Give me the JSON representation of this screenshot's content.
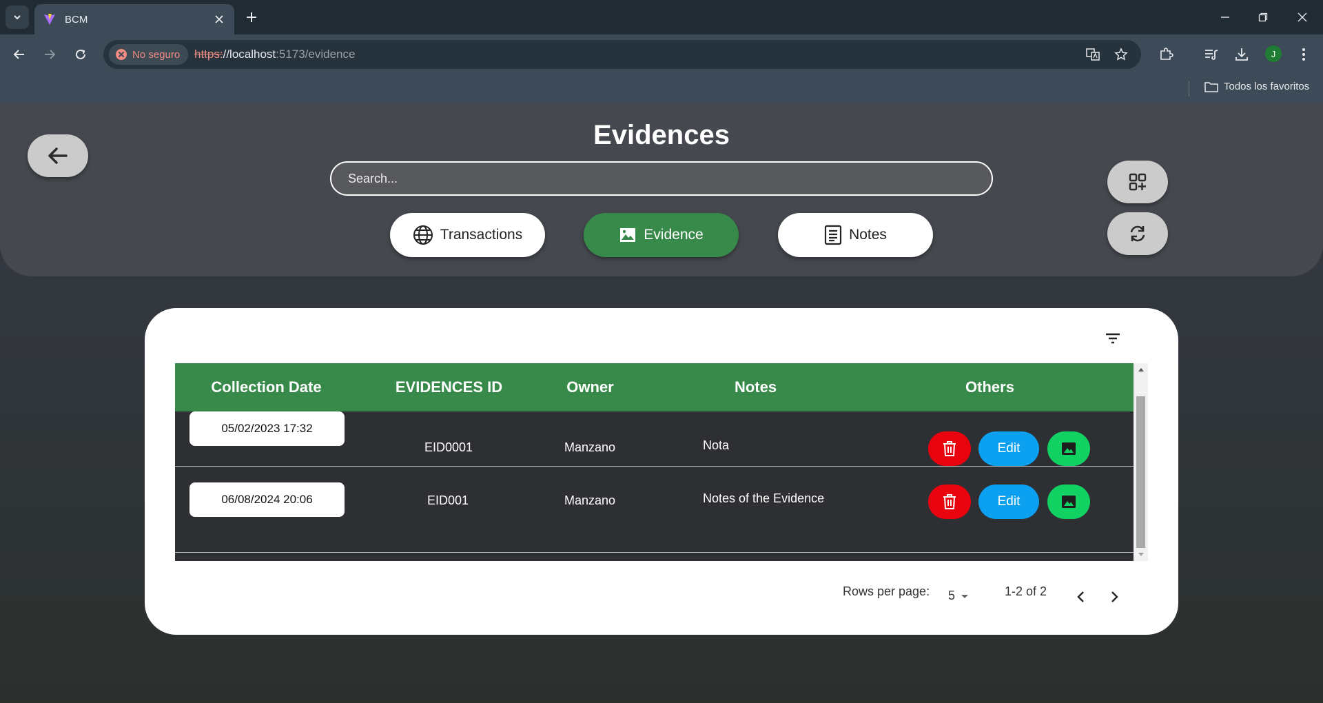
{
  "browser": {
    "tab_title": "BCM",
    "security_label": "No seguro",
    "url_scheme": "https:",
    "url_host": "//localhost",
    "url_rest": ":5173/evidence",
    "avatar_letter": "J",
    "bookmarks_label": "Todos los favoritos"
  },
  "header": {
    "title": "Evidences",
    "search_placeholder": "Search...",
    "tabs": [
      {
        "label": "Transactions",
        "icon": "globe-icon",
        "active": false
      },
      {
        "label": "Evidence",
        "icon": "image-icon",
        "active": true
      },
      {
        "label": "Notes",
        "icon": "document-icon",
        "active": false
      }
    ]
  },
  "table": {
    "columns": [
      "Collection Date",
      "EVIDENCES ID",
      "Owner",
      "Notes",
      "Others"
    ],
    "rows": [
      {
        "date": "05/02/2023 17:32",
        "id": "EID0001",
        "owner": "Manzano",
        "notes": "Nota",
        "edit_label": "Edit"
      },
      {
        "date": "06/08/2024 20:06",
        "id": "EID001",
        "owner": "Manzano",
        "notes": "Notes of the Evidence",
        "edit_label": "Edit"
      }
    ]
  },
  "pagination": {
    "rows_per_page_label": "Rows per page:",
    "rows_per_page_value": "5",
    "range_label": "1-2 of 2"
  },
  "colors": {
    "accent_green": "#378a4a",
    "delete_red": "#e8030f",
    "edit_blue": "#0ca0f0",
    "image_green": "#11d162"
  }
}
